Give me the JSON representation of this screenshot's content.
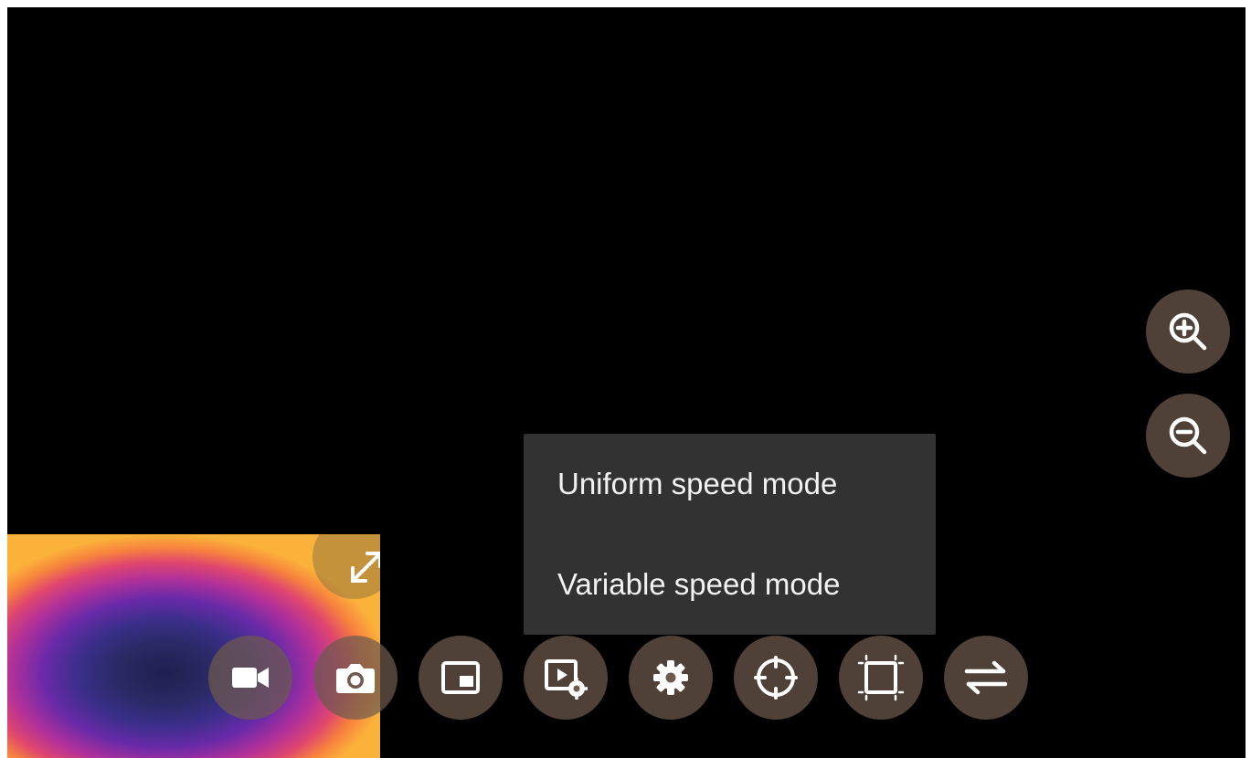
{
  "menu": {
    "items": [
      {
        "label": "Uniform speed mode"
      },
      {
        "label": "Variable speed mode"
      }
    ]
  },
  "zoom": {
    "in_icon": "zoom-in-icon",
    "out_icon": "zoom-out-icon"
  },
  "preview": {
    "expand_icon": "expand-icon"
  },
  "toolbar": {
    "buttons": [
      {
        "icon": "video-camera-icon"
      },
      {
        "icon": "camera-icon"
      },
      {
        "icon": "picture-in-picture-icon"
      },
      {
        "icon": "playback-settings-icon"
      },
      {
        "icon": "gear-icon"
      },
      {
        "icon": "crosshair-icon"
      },
      {
        "icon": "crop-frame-icon"
      },
      {
        "icon": "swap-arrows-icon"
      }
    ]
  },
  "colors": {
    "button_bg": "#6E5A4E",
    "menu_bg": "#323232",
    "menu_text": "#F2F2F2",
    "icon": "#FFFFFF"
  }
}
